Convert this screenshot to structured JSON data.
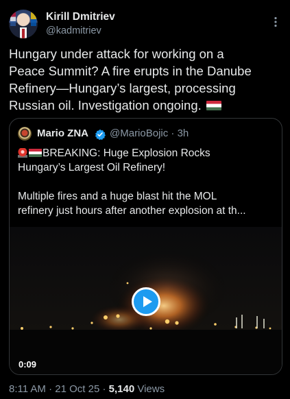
{
  "author": {
    "display_name": "Kirill Dmitriev",
    "handle": "@kadmitriev"
  },
  "tweet": {
    "lines": [
      "Hungary under attack for working on a",
      "Peace Summit? A fire erupts in the Danube",
      "Refinery—Hungary’s largest, processing",
      "Russian oil. Investigation ongoing."
    ]
  },
  "quoted": {
    "display_name": "Mario ZNA",
    "meta": "@MarioBojic · 3h",
    "headline_lines": [
      "BREAKING: Huge Explosion Rocks",
      "Hungary’s Largest Oil Refinery!"
    ],
    "body_lines": [
      "Multiple fires and a huge blast hit the MOL",
      "refinery just hours after another explosion at th..."
    ],
    "video": {
      "duration": "0:09"
    }
  },
  "footer": {
    "time": "8:11 AM · 21 Oct 25 · ",
    "views_count": "5,140",
    "views_label": " Views"
  },
  "colors": {
    "background": "#000000",
    "text": "#e7e9ea",
    "secondary": "#8b98a5",
    "accent": "#1d9bf0",
    "border": "#333639"
  },
  "icons": [
    "more-icon",
    "verified-icon",
    "play-icon",
    "hungary-flag-icon",
    "siren-icon"
  ]
}
